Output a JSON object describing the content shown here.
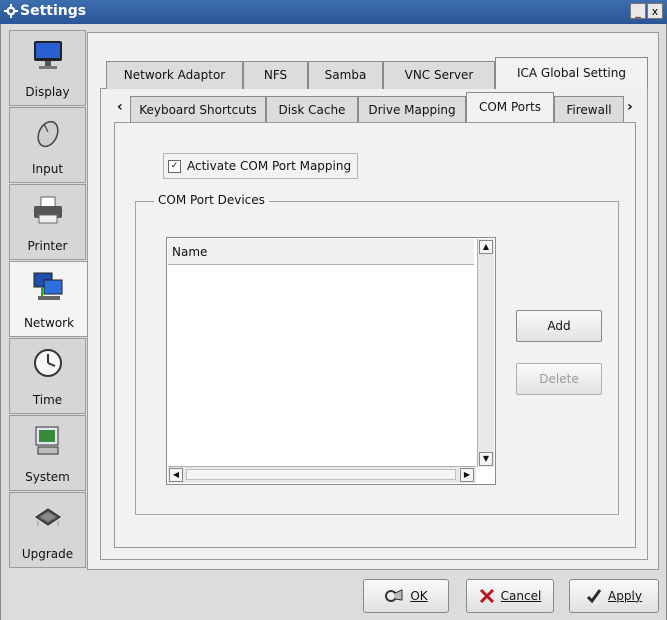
{
  "window": {
    "title": "Settings",
    "min_glyph": "_",
    "close_glyph": "x"
  },
  "sidebar": {
    "items": [
      {
        "label": "Display",
        "icon": "monitor-icon"
      },
      {
        "label": "Input",
        "icon": "mouse-icon"
      },
      {
        "label": "Printer",
        "icon": "printer-icon"
      },
      {
        "label": "Network",
        "icon": "network-icon",
        "active": true
      },
      {
        "label": "Time",
        "icon": "clock-icon"
      },
      {
        "label": "System",
        "icon": "system-icon"
      },
      {
        "label": "Upgrade",
        "icon": "chip-icon"
      }
    ]
  },
  "tabs_top": [
    {
      "label": "Network Adaptor"
    },
    {
      "label": "NFS"
    },
    {
      "label": "Samba"
    },
    {
      "label": "VNC Server"
    },
    {
      "label": "ICA Global Setting",
      "active": true
    }
  ],
  "tabs_sub": {
    "left_arrow": "‹",
    "right_arrow": "›",
    "items": [
      {
        "label": "Keyboard Shortcuts"
      },
      {
        "label": "Disk Cache"
      },
      {
        "label": "Drive Mapping"
      },
      {
        "label": "COM Ports",
        "active": true
      },
      {
        "label": "Firewall"
      }
    ]
  },
  "com": {
    "activate_label": "Activate COM Port Mapping",
    "activate_checked": true,
    "check_glyph": "✓",
    "group_label": "COM Port Devices",
    "list_header": "Name",
    "add_label": "Add",
    "delete_label": "Delete"
  },
  "buttons": {
    "ok": "OK",
    "cancel": "Cancel",
    "apply": "Apply"
  },
  "colors": {
    "titlebar": "#2f5e9e",
    "cancel_x": "#c0141c",
    "apply_check": "#2a2a2a"
  }
}
